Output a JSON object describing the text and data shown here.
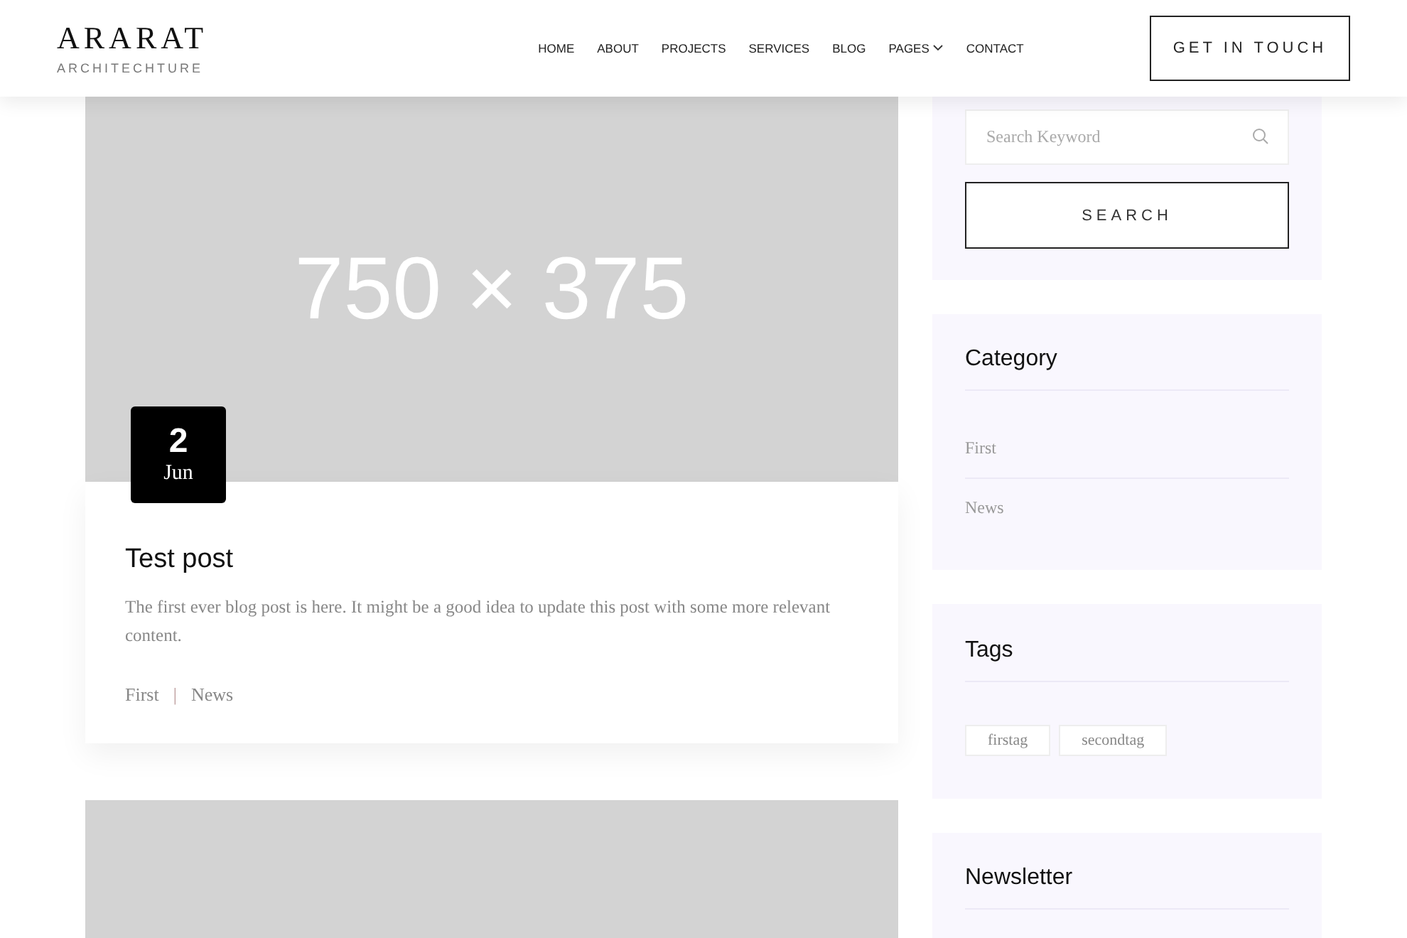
{
  "header": {
    "logo": {
      "name": "ARARAT",
      "tagline": "ARCHITECHTURE"
    },
    "nav": [
      {
        "label": "HOME",
        "has_menu": false
      },
      {
        "label": "ABOUT",
        "has_menu": false
      },
      {
        "label": "PROJECTS",
        "has_menu": false
      },
      {
        "label": "SERVICES",
        "has_menu": false
      },
      {
        "label": "BLOG",
        "has_menu": false
      },
      {
        "label": "PAGES",
        "has_menu": true
      },
      {
        "label": "CONTACT",
        "has_menu": false
      }
    ],
    "cta": "GET IN TOUCH"
  },
  "posts": [
    {
      "kind": "placeholder",
      "image_label": "750 × 375",
      "date": {
        "day": "2",
        "month": "Jun"
      },
      "title": "Test post",
      "excerpt": "The first ever blog post is here. It might be a good idea to update this post with some more relevant content.",
      "categories": [
        "First",
        "News"
      ],
      "separator": "|"
    },
    {
      "kind": "placeholder"
    }
  ],
  "sidebar": {
    "search": {
      "placeholder": "Search Keyword",
      "button": "SEARCH"
    },
    "category": {
      "title": "Category",
      "items": [
        "First",
        "News"
      ]
    },
    "tags": {
      "title": "Tags",
      "items": [
        "firstag",
        "secondtag"
      ]
    },
    "newsletter": {
      "title": "Newsletter"
    }
  }
}
